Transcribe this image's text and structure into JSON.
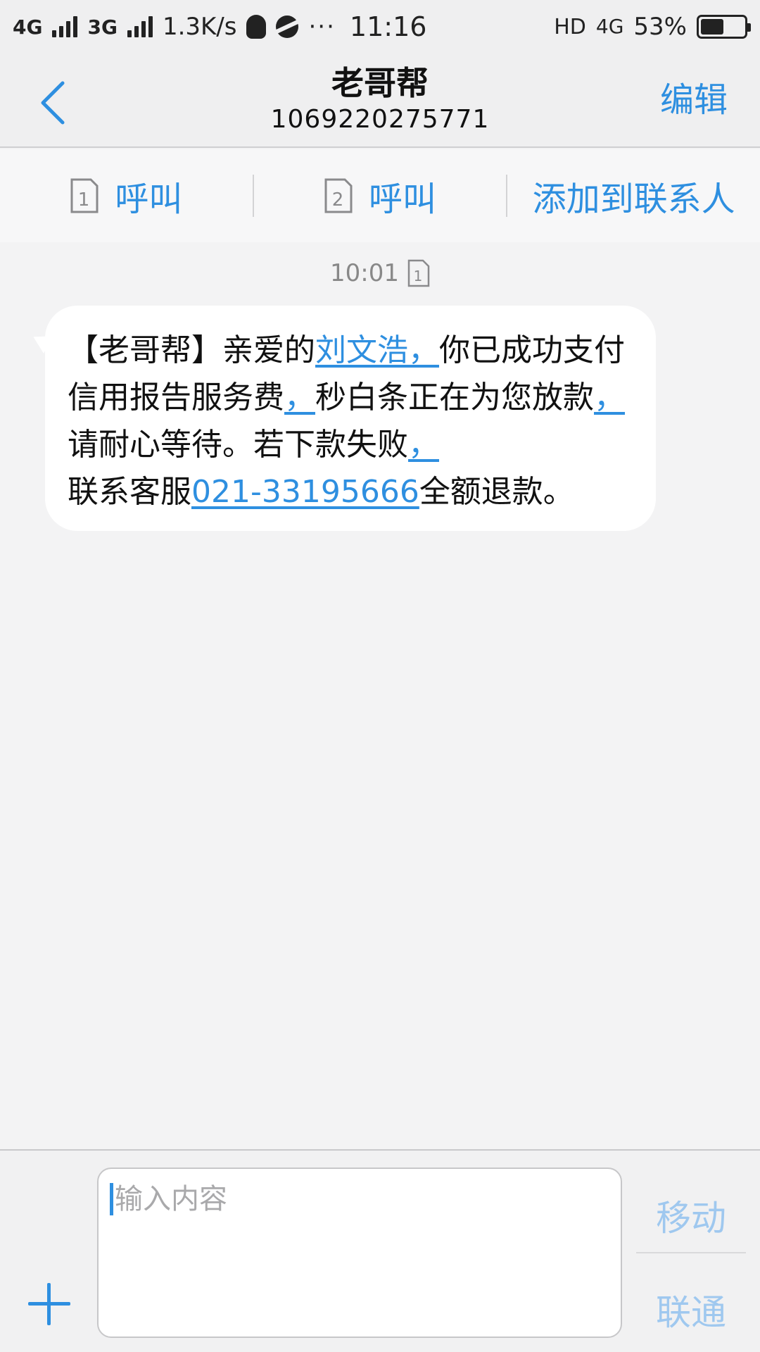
{
  "status_bar": {
    "net1": "4G",
    "net2": "3G",
    "speed": "1.3K/s",
    "more": "···",
    "time": "11:16",
    "hd": "HD",
    "net4g": "4G",
    "battery": "53%",
    "battery_level": 0.53,
    "icons": [
      "qq-icon",
      "globe-icon",
      "battery-icon"
    ]
  },
  "header": {
    "title": "老哥帮",
    "number": "1069220275771",
    "edit_label": "编辑",
    "back_icon": "chevron-left-icon"
  },
  "actions": {
    "call_sim1_label": "呼叫",
    "sim1_number": "1",
    "call_sim2_label": "呼叫",
    "sim2_number": "2",
    "add_contact_label": "添加到联系人"
  },
  "thread": {
    "timestamp": "10:01",
    "timestamp_sim": "1",
    "message": {
      "seg1": "【老哥帮】亲爱的",
      "link1": "刘文浩，",
      "seg2": "你已成功支付信用报告服务费",
      "link2": "，",
      "seg3": "秒白条正在为您放款",
      "link3": "，",
      "seg4": "请耐心等待。若下款失败",
      "link4": "，",
      "seg5": "联系客服",
      "link5": "021-33195666",
      "seg6": "全额退款。"
    }
  },
  "composer": {
    "placeholder": "输入内容",
    "send_sim1_label": "移动",
    "send_sim2_label": "联通"
  },
  "colors": {
    "accent": "#2e8fe0",
    "accent_disabled": "#9fc8ef",
    "background": "#f3f3f4",
    "bubble": "#ffffff"
  }
}
